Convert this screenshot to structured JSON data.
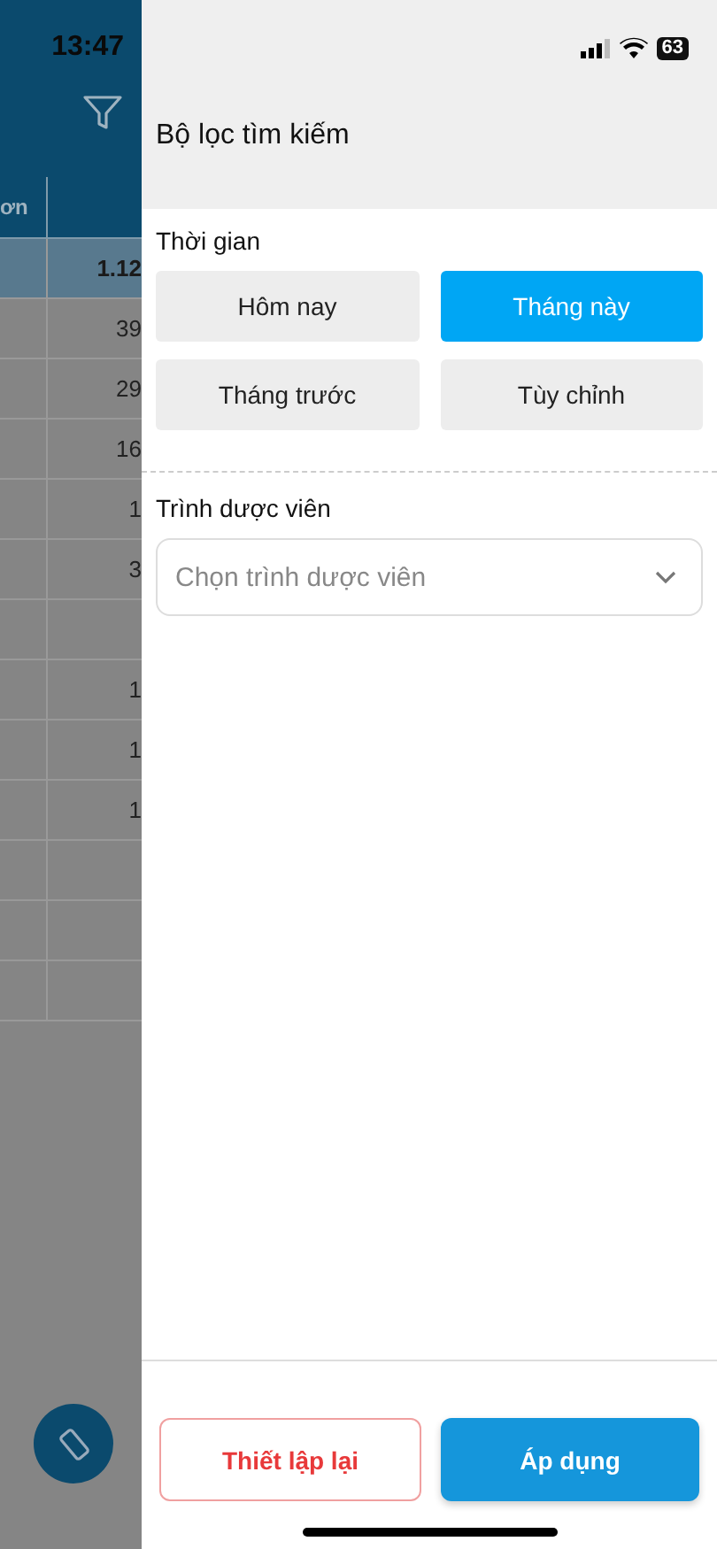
{
  "status_bar": {
    "time": "13:47",
    "battery": "63"
  },
  "background_table": {
    "columns": [
      "ơn",
      ""
    ],
    "rows": [
      {
        "cells": [
          "",
          "1.12"
        ],
        "selected": true
      },
      {
        "cells": [
          "",
          "39"
        ],
        "selected": false
      },
      {
        "cells": [
          "",
          "29"
        ],
        "selected": false
      },
      {
        "cells": [
          "",
          "16"
        ],
        "selected": false
      },
      {
        "cells": [
          "",
          "1"
        ],
        "selected": false
      },
      {
        "cells": [
          "",
          "3"
        ],
        "selected": false
      },
      {
        "cells": [
          "",
          ""
        ],
        "selected": false
      },
      {
        "cells": [
          "",
          "1"
        ],
        "selected": false
      },
      {
        "cells": [
          "",
          "1"
        ],
        "selected": false
      },
      {
        "cells": [
          "",
          "1"
        ],
        "selected": false
      },
      {
        "cells": [
          "",
          ""
        ],
        "selected": false
      },
      {
        "cells": [
          "",
          ""
        ],
        "selected": false
      },
      {
        "cells": [
          "",
          ""
        ],
        "selected": false
      }
    ]
  },
  "drawer": {
    "title": "Bộ lọc tìm kiếm",
    "time_section": {
      "label": "Thời gian",
      "options": [
        {
          "label": "Hôm nay",
          "selected": false
        },
        {
          "label": "Tháng này",
          "selected": true
        },
        {
          "label": "Tháng trước",
          "selected": false
        },
        {
          "label": "Tùy chỉnh",
          "selected": false
        }
      ]
    },
    "rep_section": {
      "label": "Trình dược viên",
      "placeholder": "Chọn trình dược viên"
    },
    "buttons": [
      {
        "label": "Thiết lập lại",
        "kind": "reset"
      },
      {
        "label": "Áp dụng",
        "kind": "apply"
      }
    ]
  }
}
